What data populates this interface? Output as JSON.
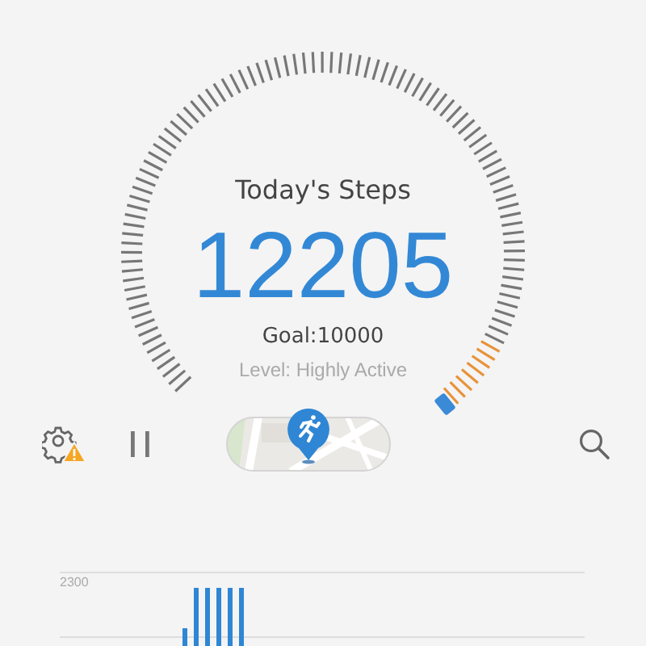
{
  "dial": {
    "title": "Today's Steps",
    "steps": "12205",
    "goal": "Goal:10000",
    "level_text": "Level: Highly Active"
  },
  "activity_chart": {
    "gridline_labels": [
      "2300"
    ]
  }
}
